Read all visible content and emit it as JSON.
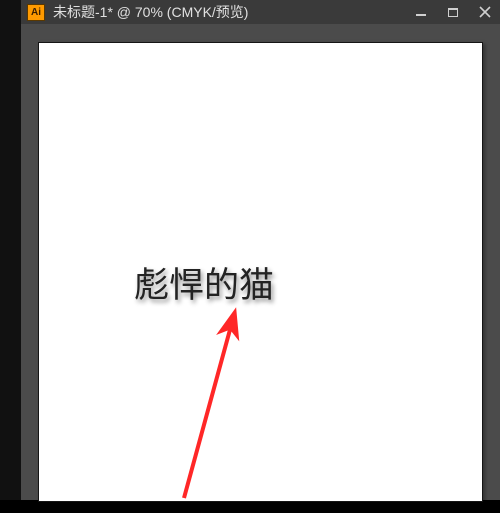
{
  "window": {
    "app_icon_label": "Ai",
    "title": "未标题-1* @ 70% (CMYK/预览)"
  },
  "canvas": {
    "text": "彪悍的猫"
  },
  "colors": {
    "accent": "#ff9a00",
    "arrow": "#ff2727"
  }
}
